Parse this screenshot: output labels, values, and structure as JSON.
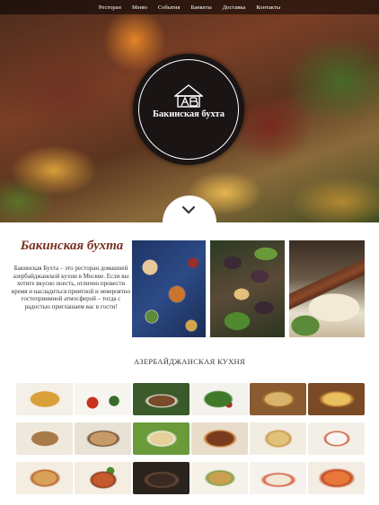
{
  "nav": {
    "items": [
      "Ресторан",
      "Меню",
      "События",
      "Банкеты",
      "Доставка",
      "Контакты"
    ]
  },
  "logo": {
    "text": "Бакинская бухта"
  },
  "intro": {
    "title": "Бакинская бухта",
    "text": "Бакинская Бухта – это ресторан домашней азербайджанской кухни в Москве. Если вы хотите вкусно поесть, отлично провести время и насладиться приятной и невероятно гостеприимной атмосферой – тогда с радостью приглашаем вас в гости!"
  },
  "section": {
    "title": "АЗЕРБАЙДЖАНСКАЯ КУХНЯ"
  },
  "icons": {
    "logo": "emblem-icon",
    "scroll": "chevron-down-icon"
  },
  "colors": {
    "accent": "#7a3020",
    "nav_bg": "#000000",
    "logo_bg": "#1a1414"
  }
}
